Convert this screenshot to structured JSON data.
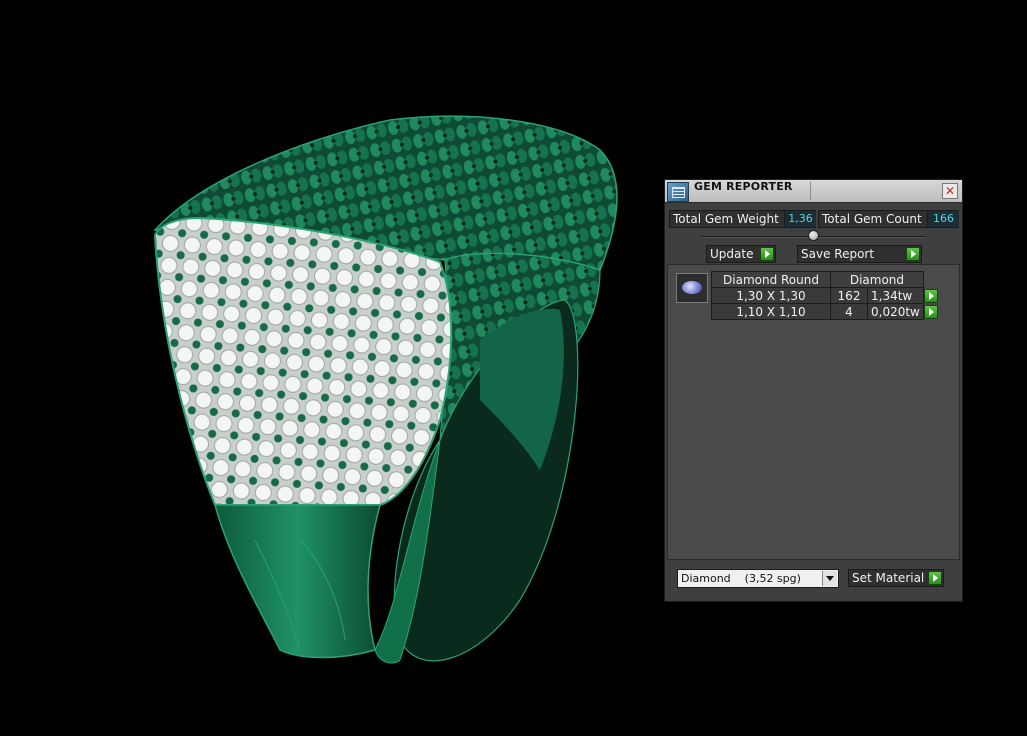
{
  "panel": {
    "title": "GEM REPORTER",
    "close_glyph": "✕",
    "total_weight_label": "Total Gem Weight",
    "total_weight_value": "1,36",
    "total_count_label": "Total Gem Count",
    "total_count_value": "166",
    "update_label": "Update",
    "save_report_label": "Save Report",
    "gem_icon": "round-diamond-icon",
    "table": {
      "headers": [
        "Diamond Round",
        "Diamond"
      ],
      "rows": [
        {
          "size": "1,30 X 1,30",
          "count": "162",
          "weight": "1,34tw"
        },
        {
          "size": "1,10 X 1,10",
          "count": "4",
          "weight": "0,020tw"
        }
      ]
    },
    "material_select": "Diamond    (3,52 spg)",
    "set_material_label": "Set Material",
    "colors": {
      "value_text": "#4fd6e6",
      "play_green": "#3fa32e",
      "model_green": "#1b7a55"
    }
  }
}
